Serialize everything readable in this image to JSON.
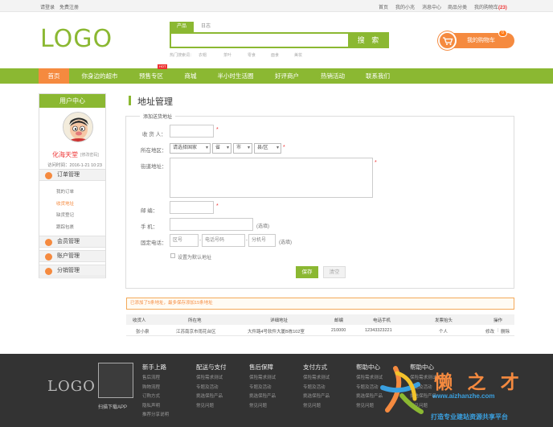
{
  "topbar": {
    "login": "请登录",
    "register": "免费注册",
    "home": "首页",
    "my_shop": "我的小兆",
    "messages": "消息中心",
    "categories": "商品分类",
    "my_cart": "我的购物车",
    "cart_count": "(23)"
  },
  "logo": "LOGO",
  "search": {
    "tabs": [
      "产品",
      "日志"
    ],
    "button": "搜  索",
    "hotwords_label": "热门搜索词：",
    "hotwords": [
      "衣帽",
      "茶叶",
      "零食",
      "面食",
      "美妆"
    ]
  },
  "cart": {
    "label": "我的购物车",
    "count": "0"
  },
  "nav": {
    "hot_badge": "HOT",
    "items": [
      "首页",
      "你身边的超市",
      "预售专区",
      "商城",
      "半小时生活圈",
      "好评商户",
      "热销活动",
      "联系我们"
    ]
  },
  "sidebar": {
    "title": "用户中心",
    "username": "化海天堂",
    "edit_password": "[修改密码]",
    "visit_label": "访问时间：",
    "visit_time": "2016-1-21 10:23",
    "order_mgmt": "订单管理",
    "order_links": [
      "我的订单",
      "收货地址",
      "缺货登记",
      "跟踪包裹"
    ],
    "member_mgmt": "会员管理",
    "account_mgmt": "账户管理",
    "share_mgmt": "分销管理"
  },
  "page_title": "地址管理",
  "form": {
    "legend": "添加送货地址",
    "receiver_label": "收 货 人：",
    "region_label": "所在地区：",
    "country": "请选择国家",
    "province": "省",
    "city": "市",
    "district": "县/区",
    "street_label": "街道地址：",
    "zip_label": "邮    编：",
    "mobile_label": "手    机：",
    "optional": "(选填)",
    "phone_label": "固定电话：",
    "area_code": "区号",
    "phone_number": "电话号码",
    "extension": "分机号",
    "default_label": "设置为默认地址",
    "save": "保存",
    "clear": "清空"
  },
  "notice": "已添加了5条地址，最多保存添加15条地址",
  "table": {
    "headers": [
      "收货人",
      "所在地",
      "详细地址",
      "邮编",
      "电话手机",
      "发票抬头",
      "操作"
    ],
    "rows": [
      {
        "name": "张小泉",
        "region": "江苏南京市雨花台区",
        "address": "大件路4号软件大厦B栋102室",
        "zip": "210000",
        "phone": "12343323221",
        "invoice": "个人",
        "edit": "修改",
        "delete": "删除"
      }
    ]
  },
  "footer": {
    "logo": "LOGO",
    "qr_caption": "扫描下载APP",
    "columns": [
      {
        "title": "新手上路",
        "links": [
          "售后流程",
          "购物流程",
          "订购方式",
          "隐私声明",
          "推荐分享说明"
        ]
      },
      {
        "title": "配送与支付",
        "links": [
          "保险需求测试",
          "专题及活动",
          "挑选保险产品",
          "常见问题"
        ]
      },
      {
        "title": "售后保障",
        "links": [
          "保险需求测试",
          "专题及活动",
          "挑选保险产品",
          "常见问题"
        ]
      },
      {
        "title": "支付方式",
        "links": [
          "保险需求测试",
          "专题及活动",
          "挑选保险产品",
          "常见问题"
        ]
      },
      {
        "title": "帮助中心",
        "links": [
          "保险需求测试",
          "专题及活动",
          "挑选保险产品",
          "常见问题"
        ]
      },
      {
        "title": "帮助中心",
        "links": [
          "保险需求测试",
          "专题及活动",
          "挑选保险产品",
          "常见问题"
        ]
      }
    ]
  },
  "watermark": {
    "brand": "懒 之 才",
    "url": "www.aizhanzhe.com",
    "slogan": "打造专业建站资源共享平台"
  },
  "colors": {
    "brand_green": "#8bb832",
    "accent_orange": "#f58a3f",
    "footer_bg": "#333333"
  }
}
